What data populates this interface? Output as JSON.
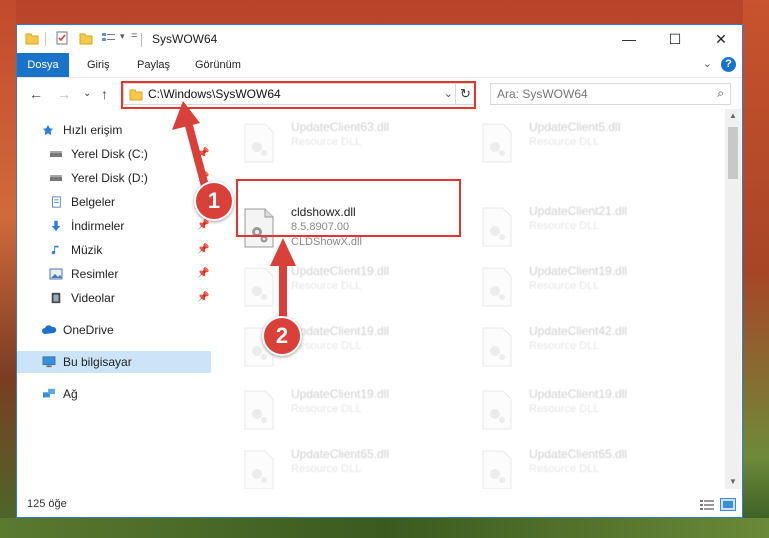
{
  "window": {
    "title": "SysWOW64",
    "minimize": "—",
    "maximize": "☐",
    "close": "✕"
  },
  "ribbon": {
    "tabs": [
      "Dosya",
      "Giriş",
      "Paylaş",
      "Görünüm"
    ],
    "expand": "⌄",
    "help": "?"
  },
  "address": {
    "path": "C:\\Windows\\SysWOW64",
    "dropdown": "⌄",
    "refresh": "↻"
  },
  "search": {
    "placeholder": "Ara: SysWOW64"
  },
  "nav": {
    "back": "←",
    "forward": "→",
    "recent": "⌄",
    "up": "↑"
  },
  "sidebar": {
    "items": [
      {
        "label": "Hızlı erişim",
        "icon": "star-icon",
        "pinned": false
      },
      {
        "label": "Yerel Disk (C:)",
        "icon": "drive-icon",
        "pinned": true
      },
      {
        "label": "Yerel Disk (D:)",
        "icon": "drive-icon",
        "pinned": true
      },
      {
        "label": "Belgeler",
        "icon": "documents-icon",
        "pinned": true
      },
      {
        "label": "İndirmeler",
        "icon": "download-icon",
        "pinned": true
      },
      {
        "label": "Müzik",
        "icon": "music-icon",
        "pinned": true
      },
      {
        "label": "Resimler",
        "icon": "pictures-icon",
        "pinned": true
      },
      {
        "label": "Videolar",
        "icon": "video-icon",
        "pinned": true
      },
      {
        "label": "OneDrive",
        "icon": "cloud-icon",
        "pinned": false
      },
      {
        "label": "Bu bilgisayar",
        "icon": "computer-icon",
        "pinned": false
      },
      {
        "label": "Ağ",
        "icon": "network-icon",
        "pinned": false
      }
    ]
  },
  "files": {
    "left": [
      {
        "name": "UpdateClient63.dll",
        "desc": "Resource DLL"
      },
      {
        "name": "cldshowx.dll",
        "desc": "8.5.8907.00",
        "desc2": "CLDShowX.dll"
      },
      {
        "name": "UpdateClient19.dll",
        "desc": "Resource DLL"
      },
      {
        "name": "UpdateClient19.dll",
        "desc": "Resource DLL"
      },
      {
        "name": "UpdateClient19.dll",
        "desc": "Resource DLL"
      },
      {
        "name": "UpdateClient65.dll",
        "desc": "Resource DLL"
      }
    ],
    "right": [
      {
        "name": "UpdateClient5.dll",
        "desc": "Resource DLL"
      },
      {
        "name": "UpdateClient21.dll",
        "desc": "Resource DLL"
      },
      {
        "name": "UpdateClient19.dll",
        "desc": "Resource DLL"
      },
      {
        "name": "UpdateClient42.dll",
        "desc": "Resource DLL"
      },
      {
        "name": "UpdateClient19.dll",
        "desc": "Resource DLL"
      },
      {
        "name": "UpdateClient65.dll",
        "desc": "Resource DLL"
      }
    ]
  },
  "status": {
    "count": "125 öğe"
  },
  "annotations": {
    "badge1": "1",
    "badge2": "2",
    "color": "#e0362e"
  }
}
